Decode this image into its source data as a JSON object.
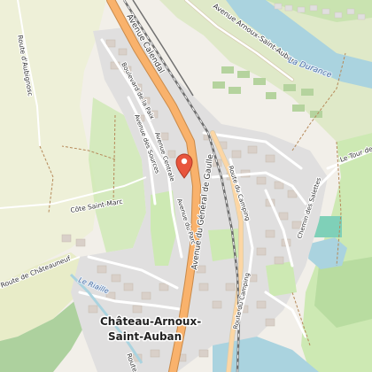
{
  "map": {
    "town": {
      "line1": "Château-Arnoux-",
      "line2": "Saint-Auban"
    },
    "rivers": {
      "durance": "La Durance",
      "riaille": "Le Riaille"
    },
    "roads": {
      "calendal": "Avenue Calendal",
      "de_gaulle": "Avenue du Général de Gaulle",
      "arnoux_auban": "Avenue Arnoux-Saint-Auban",
      "aubignosc": "Route d'Aubignosc",
      "boulevard_paix": "Boulevard de la Paix",
      "sources": "Avenue des Sources",
      "centrale": "Avenue Centrale",
      "parc": "Avenue du Parc",
      "cote_st_marc": "Côte Saint-Marc",
      "chateauneuf": "Route de Châteauneuf",
      "camping_1": "Route du Camping",
      "camping_2": "Route du Camping",
      "chemin_salettes": "Chemin des Salettes",
      "tour": "Le Tour de",
      "route_de": "Route de"
    },
    "marker": {
      "icon": "map-pin-icon",
      "color": "#e8553d"
    },
    "colors": {
      "land": "#f2efe9",
      "fields": "#eef0d8",
      "grass": "#cde9b3",
      "forest": "#add19e",
      "water": "#aad3df",
      "residential": "#e0dfdf",
      "building": "#d9d0c9",
      "major_road": "#f9b26c",
      "railway": "#707070"
    }
  }
}
